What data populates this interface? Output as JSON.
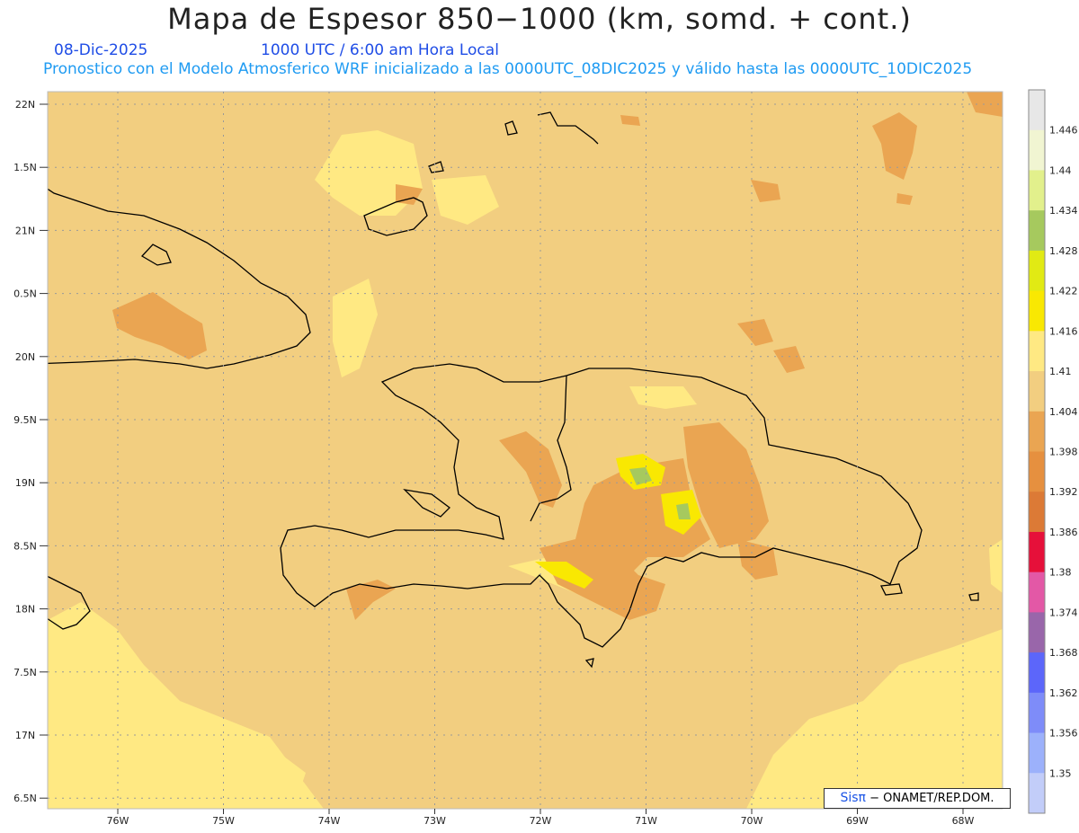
{
  "header": {
    "title": "Mapa de Espesor 850−1000 (km, somd. + cont.)",
    "date": "08-Dic-2025",
    "valid_time": "1000 UTC / 6:00 am Hora Local",
    "description": "Pronostico con el Modelo Atmosferico WRF inicializado a las 0000UTC_08DIC2025 y válido hasta las  0000UTC_10DIC2025"
  },
  "axes": {
    "lat_labels": [
      "22N",
      "1.5N",
      "21N",
      "0.5N",
      "20N",
      "9.5N",
      "19N",
      "8.5N",
      "18N",
      "7.5N",
      "17N",
      "6.5N"
    ],
    "lon_labels": [
      "76W",
      "75W",
      "74W",
      "73W",
      "72W",
      "71W",
      "70W",
      "69W",
      "68W"
    ]
  },
  "legend": {
    "levels": [
      "1.446",
      "1.44",
      "1.434",
      "1.428",
      "1.422",
      "1.416",
      "1.41",
      "1.404",
      "1.398",
      "1.392",
      "1.386",
      "1.38",
      "1.374",
      "1.368",
      "1.362",
      "1.356",
      "1.35"
    ],
    "colors_top_to_bottom": [
      "#e7e7e7",
      "#f1f5d2",
      "#e2f08c",
      "#a6c95e",
      "#e1ea14",
      "#f9e802",
      "#ffe983",
      "#f2ce80",
      "#eaa552",
      "#e6903f",
      "#dc7a36",
      "#e6103a",
      "#e358a6",
      "#9966aa",
      "#5c66fa",
      "#7e8cf9",
      "#9cb1fb",
      "#c2cdf9"
    ]
  },
  "credit": {
    "brand": "Sisπ",
    "text": "− ONAMET/REP.DOM."
  },
  "colors": {
    "background_field": "#f2ce80",
    "subtitle_blue": "#1f4de6",
    "description_blue": "#1f9bf2"
  }
}
